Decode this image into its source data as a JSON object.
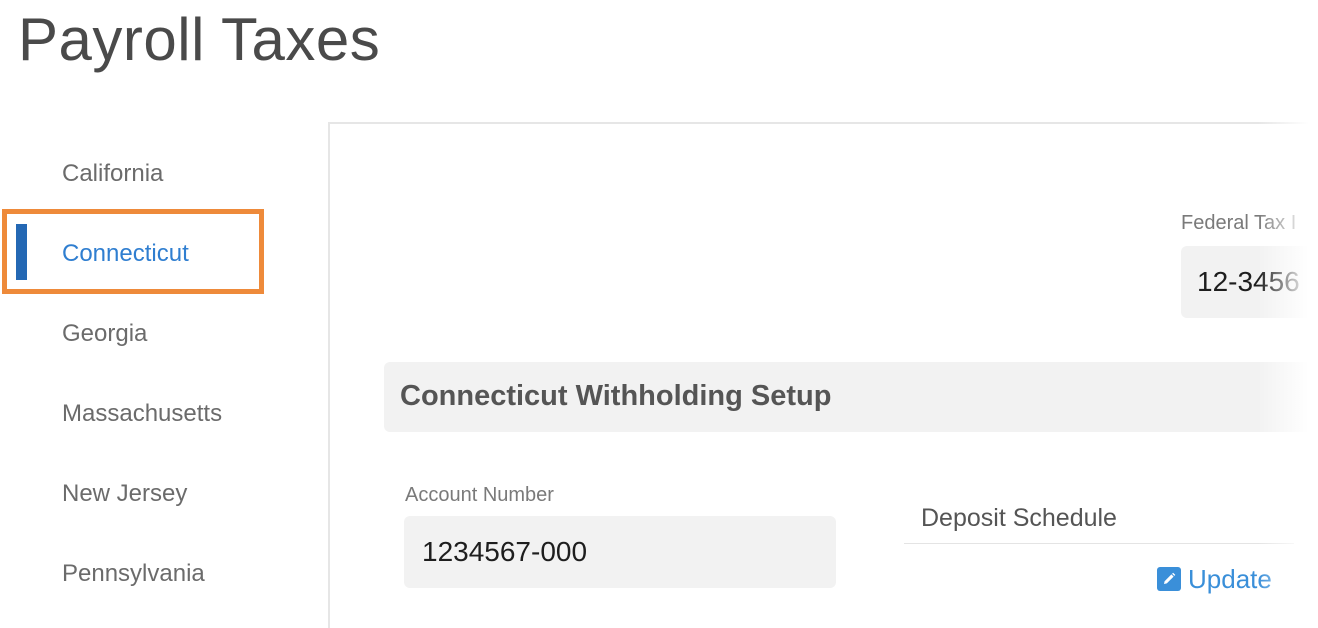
{
  "page": {
    "title": "Payroll Taxes"
  },
  "states": [
    {
      "label": "California"
    },
    {
      "label": "Connecticut"
    },
    {
      "label": "Georgia"
    },
    {
      "label": "Massachusetts"
    },
    {
      "label": "New Jersey"
    },
    {
      "label": "Pennsylvania"
    }
  ],
  "selected_state": "Connecticut",
  "federal": {
    "label": "Federal Tax I",
    "value": "12-3456"
  },
  "section": {
    "title": "Connecticut Withholding Setup"
  },
  "account": {
    "label": "Account Number",
    "value": "1234567-000"
  },
  "deposit": {
    "label": "Deposit Schedule",
    "update_label": "Update",
    "update_icon": "edit-pencil-icon"
  },
  "colors": {
    "accent": "#2f7ed0",
    "indicator": "#2468b4",
    "highlight": "#ee8a3a",
    "link": "#3a8fd9"
  }
}
